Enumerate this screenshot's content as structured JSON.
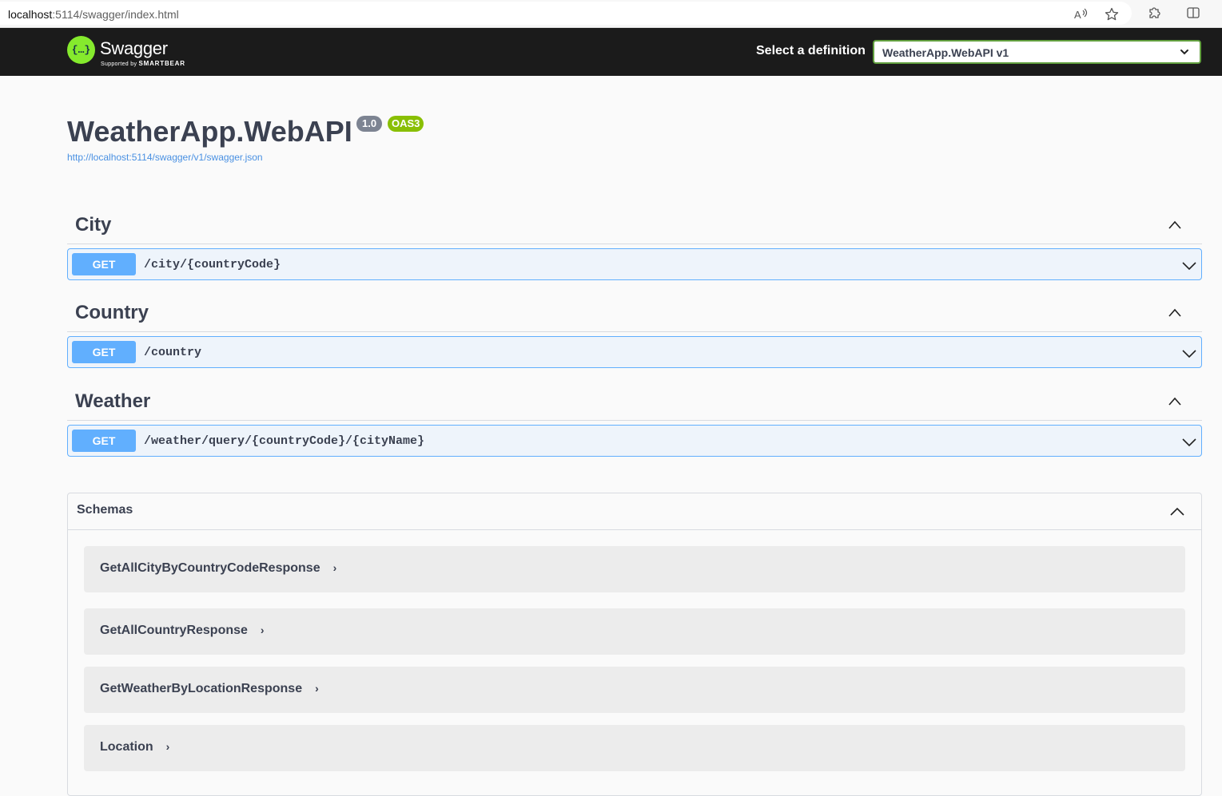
{
  "browser": {
    "url_host": "localhost",
    "url_rest": ":5114/swagger/index.html",
    "icons": [
      "read-aloud-icon",
      "favorite-star-icon",
      "extensions-icon",
      "split-screen-icon"
    ]
  },
  "topbar": {
    "logo_text": "Swagger",
    "logo_symbol": "{…}",
    "logo_sub": "Supported by",
    "logo_sub_brand": "SMARTBEAR",
    "definition_label": "Select a definition",
    "definition_value": "WeatherApp.WebAPI v1"
  },
  "info": {
    "title": "WeatherApp.WebAPI",
    "version": "1.0",
    "oas": "OAS3",
    "spec_url": "http://localhost:5114/swagger/v1/swagger.json"
  },
  "tags": [
    {
      "name": "City",
      "operations": [
        {
          "method": "GET",
          "path": "/city/{countryCode}"
        }
      ]
    },
    {
      "name": "Country",
      "operations": [
        {
          "method": "GET",
          "path": "/country"
        }
      ]
    },
    {
      "name": "Weather",
      "operations": [
        {
          "method": "GET",
          "path": "/weather/query/{countryCode}/{cityName}"
        }
      ]
    }
  ],
  "schemas": {
    "title": "Schemas",
    "models": [
      {
        "name": "GetAllCityByCountryCodeResponse"
      },
      {
        "name": "GetAllCountryResponse"
      },
      {
        "name": "GetWeatherByLocationResponse"
      },
      {
        "name": "Location"
      }
    ]
  },
  "colors": {
    "get": "#61affe",
    "topbar": "#1b1b1b",
    "oas_badge": "#89bf04",
    "version_badge": "#7d8492",
    "select_border": "#62a03f"
  }
}
